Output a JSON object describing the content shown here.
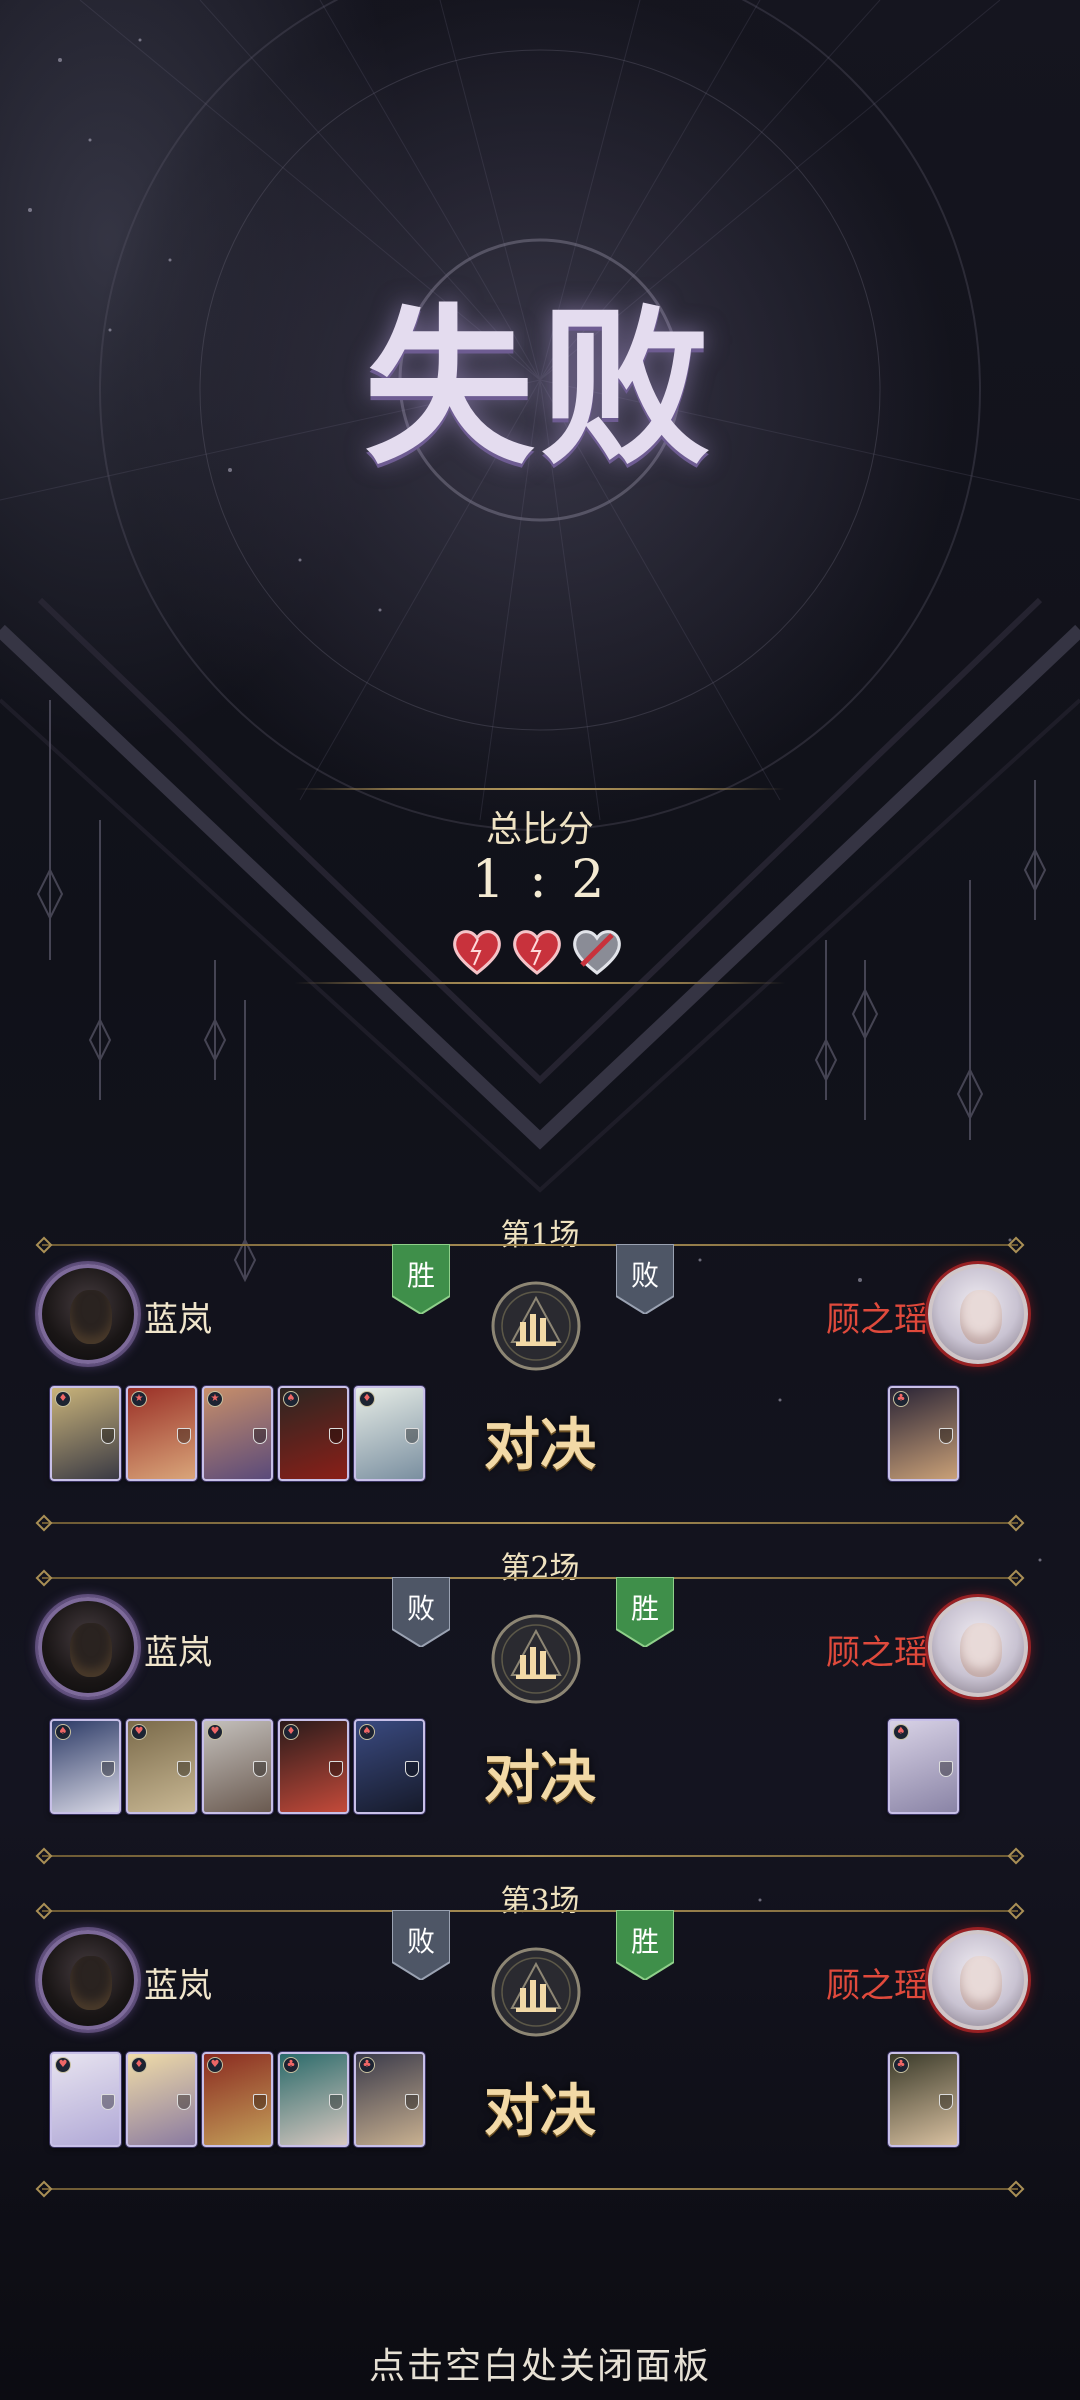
{
  "result": {
    "title": "失败"
  },
  "score": {
    "label": "总比分",
    "value": "1 : 2",
    "hearts": [
      "full",
      "full",
      "broken"
    ]
  },
  "matches": [
    {
      "title": "第1场",
      "left": {
        "name": "蓝岚",
        "badge": "胜",
        "badge_type": "win",
        "cards": [
          {
            "suit": "♦",
            "colors": [
              "#c9b37a",
              "#3a3a44"
            ]
          },
          {
            "suit": "★",
            "colors": [
              "#9a2f26",
              "#d9a57a"
            ]
          },
          {
            "suit": "★",
            "colors": [
              "#c88f6a",
              "#5a4a7a"
            ]
          },
          {
            "suit": "♠",
            "colors": [
              "#2c2622",
              "#8a1f18"
            ]
          },
          {
            "suit": "♦",
            "colors": [
              "#e6ece6",
              "#7a8fa0"
            ]
          }
        ]
      },
      "right": {
        "name": "顾之瑶",
        "badge": "败",
        "badge_type": "lose",
        "cards": [
          {
            "suit": "♣",
            "colors": [
              "#2a2436",
              "#c9a077"
            ]
          }
        ]
      },
      "vs_label": "对决"
    },
    {
      "title": "第2场",
      "left": {
        "name": "蓝岚",
        "badge": "败",
        "badge_type": "lose",
        "cards": [
          {
            "suit": "♠",
            "colors": [
              "#2c3a66",
              "#d9d9e6"
            ]
          },
          {
            "suit": "♥",
            "colors": [
              "#7a6a4a",
              "#c9b894"
            ]
          },
          {
            "suit": "♥",
            "colors": [
              "#c4c0bc",
              "#6a5a50"
            ]
          },
          {
            "suit": "♦",
            "colors": [
              "#2a1a1a",
              "#c44a3a"
            ]
          },
          {
            "suit": "♠",
            "colors": [
              "#3a4a80",
              "#161a2a"
            ]
          }
        ]
      },
      "right": {
        "name": "顾之瑶",
        "badge": "胜",
        "badge_type": "win",
        "cards": [
          {
            "suit": "♠",
            "colors": [
              "#d8d2e6",
              "#8a84a6"
            ]
          }
        ]
      },
      "vs_label": "对决"
    },
    {
      "title": "第3场",
      "left": {
        "name": "蓝岚",
        "badge": "败",
        "badge_type": "lose",
        "cards": [
          {
            "suit": "♥",
            "colors": [
              "#e8e4f0",
              "#b0a8d6"
            ]
          },
          {
            "suit": "♦",
            "colors": [
              "#f0dca8",
              "#8a7aa0"
            ]
          },
          {
            "suit": "♥",
            "colors": [
              "#8a2a20",
              "#c4a05a"
            ]
          },
          {
            "suit": "♣",
            "colors": [
              "#2a6a6a",
              "#d8c8c0"
            ]
          },
          {
            "suit": "♣",
            "colors": [
              "#3a3a4a",
              "#c8b090"
            ]
          }
        ]
      },
      "right": {
        "name": "顾之瑶",
        "badge": "胜",
        "badge_type": "win",
        "cards": [
          {
            "suit": "♣",
            "colors": [
              "#3a3a2a",
              "#d8c0a0"
            ]
          }
        ]
      },
      "vs_label": "对决"
    }
  ],
  "footer": {
    "hint": "点击空白处关闭面板"
  },
  "colors": {
    "win_badge": "#3f8f4a",
    "lose_badge": "#4e5666",
    "opponent_name": "#e04a3c",
    "gold_line": "#a98f55"
  }
}
